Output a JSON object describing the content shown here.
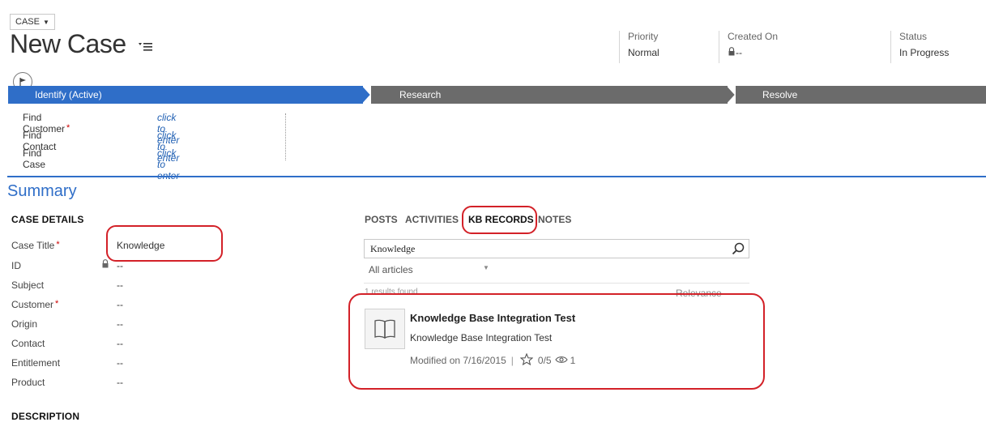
{
  "header": {
    "entity_switch": "CASE",
    "title": "New Case",
    "fields": [
      {
        "label": "Priority",
        "value": "Normal"
      },
      {
        "label": "Created On",
        "value": "--"
      },
      {
        "label": "Status",
        "value": "In Progress"
      }
    ]
  },
  "process": {
    "stages": [
      {
        "label": "Identify (Active)",
        "active": true
      },
      {
        "label": "Research",
        "active": false
      },
      {
        "label": "Resolve",
        "active": false
      }
    ],
    "fields": [
      {
        "label": "Find Customer",
        "value": "click to enter",
        "required": "*"
      },
      {
        "label": "Find Contact",
        "value": "click to enter"
      },
      {
        "label": "Find Case",
        "value": "click to enter"
      }
    ]
  },
  "summary": {
    "title": "Summary",
    "case_details_heading": "CASE DETAILS",
    "fields": [
      {
        "label": "Case Title",
        "value": "Knowledge",
        "required": "*"
      },
      {
        "label": "ID",
        "value": "--"
      },
      {
        "label": "Subject",
        "value": "--"
      },
      {
        "label": "Customer",
        "value": "--",
        "required": "*"
      },
      {
        "label": "Origin",
        "value": "--"
      },
      {
        "label": "Contact",
        "value": "--"
      },
      {
        "label": "Entitlement",
        "value": "--"
      },
      {
        "label": "Product",
        "value": "--"
      }
    ],
    "description_heading": "DESCRIPTION"
  },
  "tabs": [
    "POSTS",
    "ACTIVITIES",
    "KB RECORDS",
    "NOTES"
  ],
  "active_tab": "KB RECORDS",
  "kb": {
    "search_value": "Knowledge",
    "filter": "All articles",
    "results_count": "1 results found",
    "sort": "Relevance",
    "results": [
      {
        "title": "Knowledge Base Integration Test",
        "description": "Knowledge Base Integration Test",
        "modified": "Modified on 7/16/2015",
        "rating": "0/5",
        "views": "1",
        "icon": "book-icon"
      }
    ]
  },
  "colors": {
    "accent": "#2f6ec8",
    "stage_inactive": "#6b6b6b",
    "callout": "#d32128",
    "required": "#cc0000"
  }
}
